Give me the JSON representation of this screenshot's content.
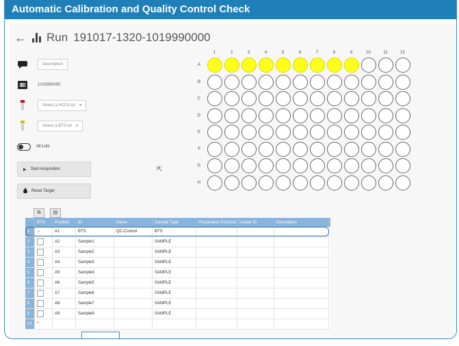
{
  "banner": {
    "title": "Automatic Calibration and Quality Control Check"
  },
  "header": {
    "back_icon": "←",
    "run_label": "Run",
    "run_id": "191017-1320-1019990000"
  },
  "left_panel": {
    "description_placeholder": "Description",
    "barcode_value": "1019990000",
    "hcca_select": "Select a HCCA lot",
    "bts_select": "Select a BTS lot",
    "all_lots_label": "All Lots",
    "start_acquisition": "Start Acquisition",
    "reset_target": "Reset Target"
  },
  "plate": {
    "columns": [
      "1",
      "2",
      "3",
      "4",
      "5",
      "6",
      "7",
      "8",
      "9",
      "10",
      "11",
      "12"
    ],
    "rows": [
      "A",
      "B",
      "C",
      "D",
      "E",
      "F",
      "G",
      "H"
    ],
    "filled_row": "A",
    "filled_count": 9,
    "filled_color": "#ffff1a"
  },
  "table": {
    "headers": [
      "BTS",
      "Position",
      "ID",
      "Name",
      "Sample Type",
      "Preparation Protocol",
      "Isolate ID",
      "Description"
    ],
    "rows": [
      {
        "n": "1",
        "bts": "✓",
        "pos": "A1",
        "id": "BTS",
        "name": "QC-Control",
        "type": "BTS"
      },
      {
        "n": "2",
        "bts": "",
        "pos": "A2",
        "id": "Sample1",
        "name": "",
        "type": "SAMPLE"
      },
      {
        "n": "3",
        "bts": "",
        "pos": "A3",
        "id": "Sample2",
        "name": "",
        "type": "SAMPLE"
      },
      {
        "n": "4",
        "bts": "",
        "pos": "A4",
        "id": "Sample3",
        "name": "",
        "type": "SAMPLE"
      },
      {
        "n": "5",
        "bts": "",
        "pos": "A5",
        "id": "Sample4",
        "name": "",
        "type": "SAMPLE"
      },
      {
        "n": "6",
        "bts": "",
        "pos": "A6",
        "id": "Sample5",
        "name": "",
        "type": "SAMPLE"
      },
      {
        "n": "7",
        "bts": "",
        "pos": "A7",
        "id": "Sample6",
        "name": "",
        "type": "SAMPLE"
      },
      {
        "n": "8",
        "bts": "",
        "pos": "A8",
        "id": "Sample7",
        "name": "",
        "type": "SAMPLE"
      },
      {
        "n": "9",
        "bts": "",
        "pos": "A9",
        "id": "Sample8",
        "name": "",
        "type": "SAMPLE"
      },
      {
        "n": "10",
        "bts": "",
        "pos": "",
        "id": "",
        "name": "",
        "type": ""
      }
    ]
  },
  "colors": {
    "banner": "#1f7fb9",
    "table_header": "#88b3db",
    "highlight": "#2b6fb0"
  }
}
